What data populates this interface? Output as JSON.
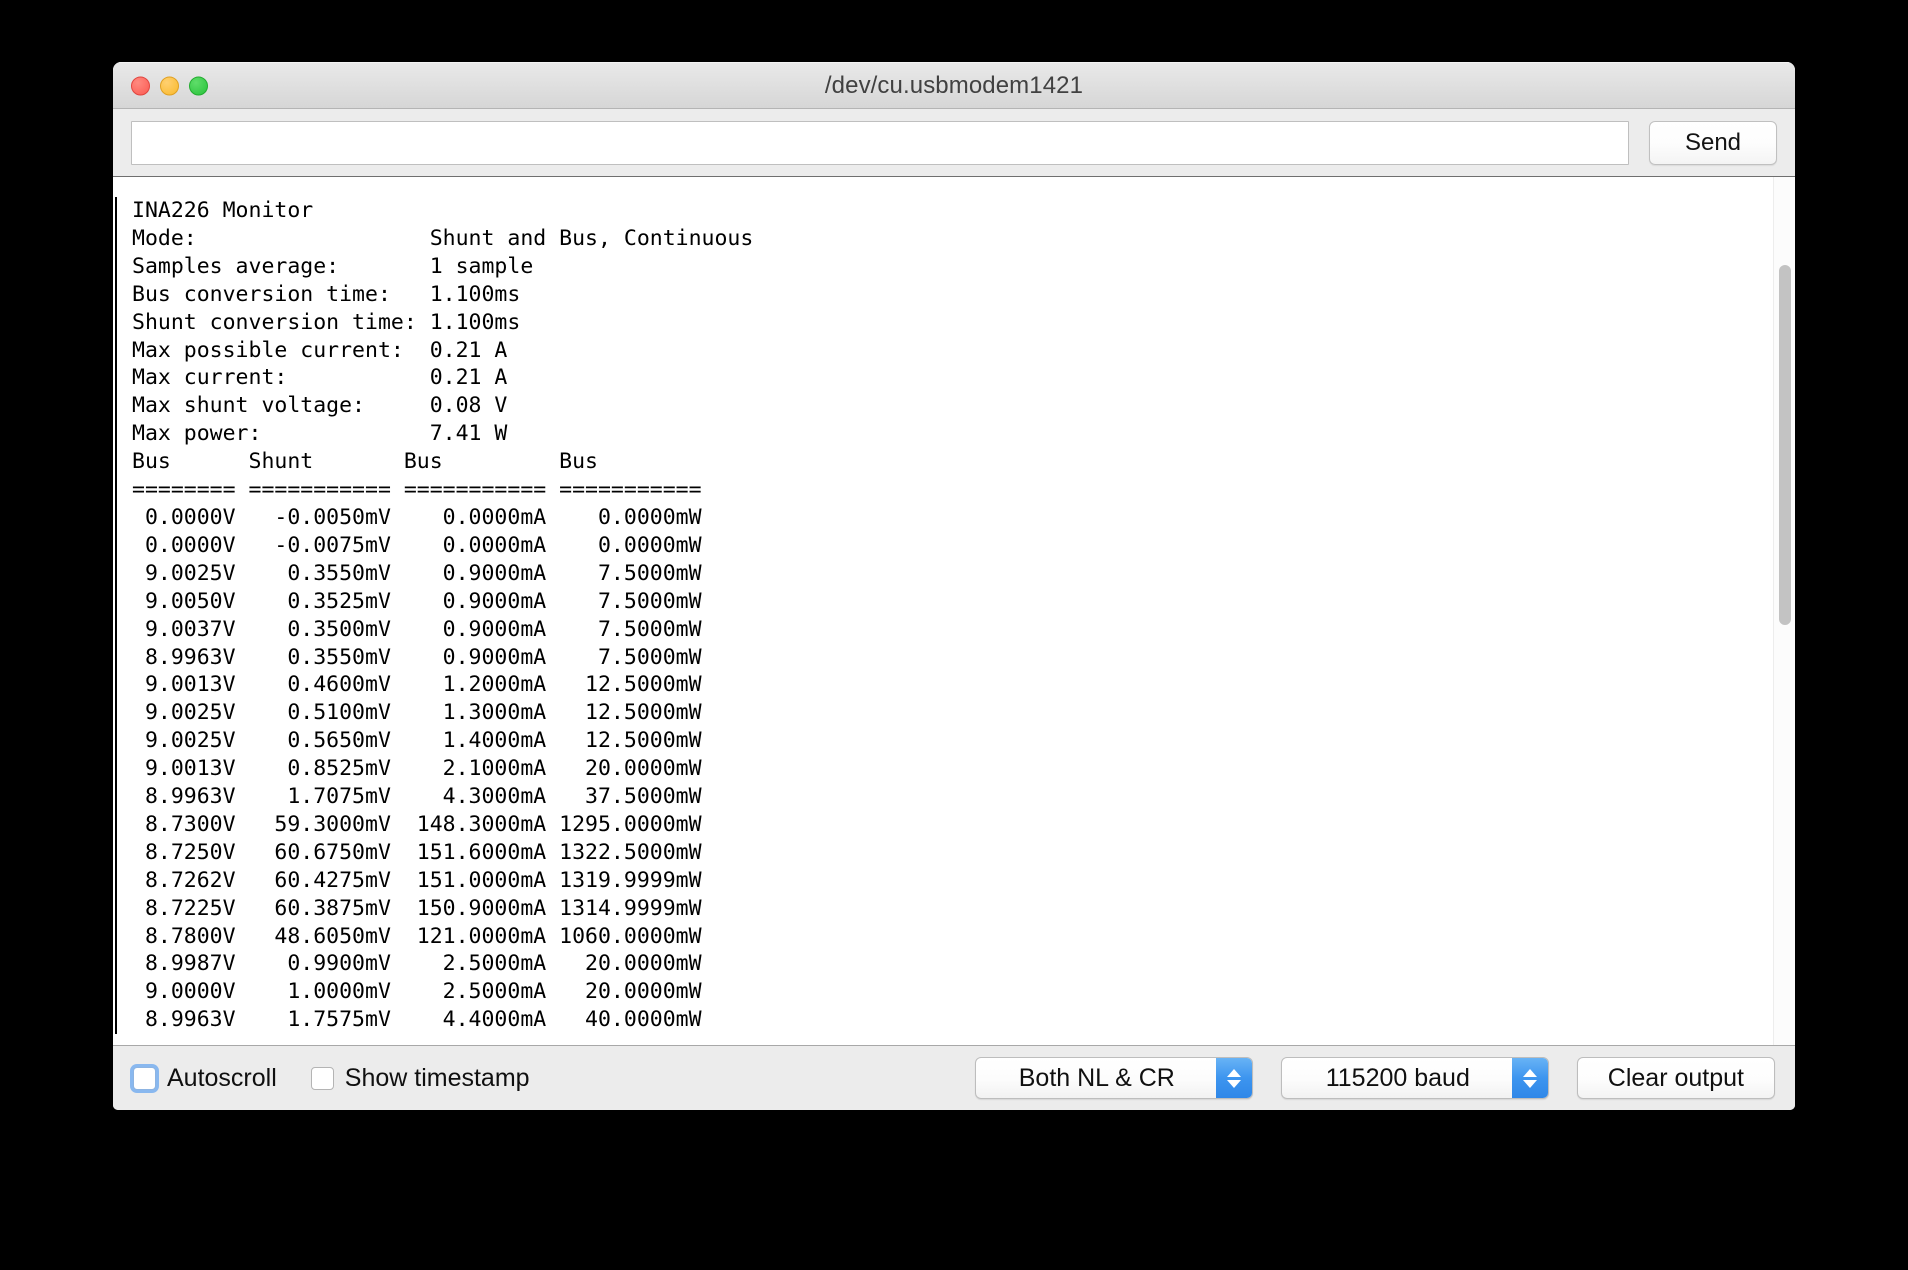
{
  "window": {
    "title": "/dev/cu.usbmodem1421",
    "traffic_lights": {
      "close": "close-button",
      "minimize": "minimize-button",
      "maximize": "maximize-button"
    },
    "colors": {
      "close": "#fb5a52",
      "minimize": "#f9b92b",
      "maximize": "#28c23a",
      "accent": "#3d95ef",
      "chrome": "#ececec",
      "console_bg": "#ffffff",
      "console_fg": "#000000"
    }
  },
  "send_bar": {
    "input_value": "",
    "input_placeholder": "",
    "send_label": "Send"
  },
  "console": {
    "title_line": "INA226 Monitor",
    "info": [
      {
        "label": "Mode:",
        "value": "Shunt and Bus, Continuous"
      },
      {
        "label": "Samples average:",
        "value": "1 sample"
      },
      {
        "label": "Bus conversion time:",
        "value": "1.100ms"
      },
      {
        "label": "Shunt conversion time:",
        "value": "1.100ms"
      },
      {
        "label": "Max possible current:",
        "value": "0.21 A"
      },
      {
        "label": "Max current:",
        "value": "0.21 A"
      },
      {
        "label": "Max shunt voltage:",
        "value": "0.08 V"
      },
      {
        "label": "Max power:",
        "value": "7.41 W"
      }
    ],
    "columns": [
      "Bus",
      "Shunt",
      "Bus",
      "Bus"
    ],
    "separator": "======== =========== =========== ===========",
    "rows": [
      {
        "bus_voltage": "0.0000V",
        "shunt_voltage": "-0.0050mV",
        "bus_current": "0.0000mA",
        "bus_power": "0.0000mW"
      },
      {
        "bus_voltage": "0.0000V",
        "shunt_voltage": "-0.0075mV",
        "bus_current": "0.0000mA",
        "bus_power": "0.0000mW"
      },
      {
        "bus_voltage": "9.0025V",
        "shunt_voltage": "0.3550mV",
        "bus_current": "0.9000mA",
        "bus_power": "7.5000mW"
      },
      {
        "bus_voltage": "9.0050V",
        "shunt_voltage": "0.3525mV",
        "bus_current": "0.9000mA",
        "bus_power": "7.5000mW"
      },
      {
        "bus_voltage": "9.0037V",
        "shunt_voltage": "0.3500mV",
        "bus_current": "0.9000mA",
        "bus_power": "7.5000mW"
      },
      {
        "bus_voltage": "8.9963V",
        "shunt_voltage": "0.3550mV",
        "bus_current": "0.9000mA",
        "bus_power": "7.5000mW"
      },
      {
        "bus_voltage": "9.0013V",
        "shunt_voltage": "0.4600mV",
        "bus_current": "1.2000mA",
        "bus_power": "12.5000mW"
      },
      {
        "bus_voltage": "9.0025V",
        "shunt_voltage": "0.5100mV",
        "bus_current": "1.3000mA",
        "bus_power": "12.5000mW"
      },
      {
        "bus_voltage": "9.0025V",
        "shunt_voltage": "0.5650mV",
        "bus_current": "1.4000mA",
        "bus_power": "12.5000mW"
      },
      {
        "bus_voltage": "9.0013V",
        "shunt_voltage": "0.8525mV",
        "bus_current": "2.1000mA",
        "bus_power": "20.0000mW"
      },
      {
        "bus_voltage": "8.9963V",
        "shunt_voltage": "1.7075mV",
        "bus_current": "4.3000mA",
        "bus_power": "37.5000mW"
      },
      {
        "bus_voltage": "8.7300V",
        "shunt_voltage": "59.3000mV",
        "bus_current": "148.3000mA",
        "bus_power": "1295.0000mW"
      },
      {
        "bus_voltage": "8.7250V",
        "shunt_voltage": "60.6750mV",
        "bus_current": "151.6000mA",
        "bus_power": "1322.5000mW"
      },
      {
        "bus_voltage": "8.7262V",
        "shunt_voltage": "60.4275mV",
        "bus_current": "151.0000mA",
        "bus_power": "1319.9999mW"
      },
      {
        "bus_voltage": "8.7225V",
        "shunt_voltage": "60.3875mV",
        "bus_current": "150.9000mA",
        "bus_power": "1314.9999mW"
      },
      {
        "bus_voltage": "8.7800V",
        "shunt_voltage": "48.6050mV",
        "bus_current": "121.0000mA",
        "bus_power": "1060.0000mW"
      },
      {
        "bus_voltage": "8.9987V",
        "shunt_voltage": "0.9900mV",
        "bus_current": "2.5000mA",
        "bus_power": "20.0000mW"
      },
      {
        "bus_voltage": "9.0000V",
        "shunt_voltage": "1.0000mV",
        "bus_current": "2.5000mA",
        "bus_power": "20.0000mW"
      },
      {
        "bus_voltage": "8.9963V",
        "shunt_voltage": "1.7575mV",
        "bus_current": "4.4000mA",
        "bus_power": "40.0000mW"
      }
    ]
  },
  "toolbar": {
    "autoscroll_label": "Autoscroll",
    "autoscroll_checked": false,
    "show_timestamp_label": "Show timestamp",
    "show_timestamp_checked": false,
    "line_ending_selected": "Both NL & CR",
    "baud_selected": "115200 baud",
    "clear_label": "Clear output"
  }
}
